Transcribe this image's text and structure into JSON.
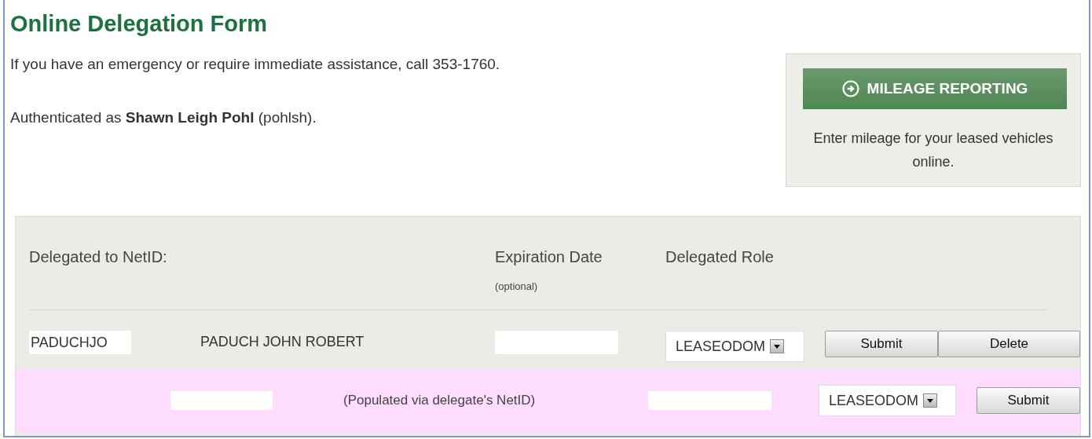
{
  "page": {
    "title": "Online Delegation Form",
    "notice": "If you have an emergency or require immediate assistance, call 353-1760.",
    "auth": "Authenticated as **Shawn Leigh Pohl** (pohlsh)."
  },
  "promo": {
    "button": "MILEAGE REPORTING",
    "description": "Enter mileage for your leased vehicles online."
  },
  "form": {
    "columns": [
      {
        "label": "Delegated to NetID:"
      },
      {
        "label": "Expiration Date",
        "note": "(optional)"
      },
      {
        "label": "Delegated Role"
      }
    ],
    "delegations": [
      {
        "netid": "PADUCHJO",
        "name": "PADUCH JOHN ROBERT",
        "role": "LEASEODOM",
        "buttons": [
          "Submit",
          "Delete"
        ]
      }
    ],
    "new_row": {
      "name_hint": "(Populated via delegate's NetID)",
      "role": "LEASEODOM",
      "button": "Submit"
    }
  }
}
